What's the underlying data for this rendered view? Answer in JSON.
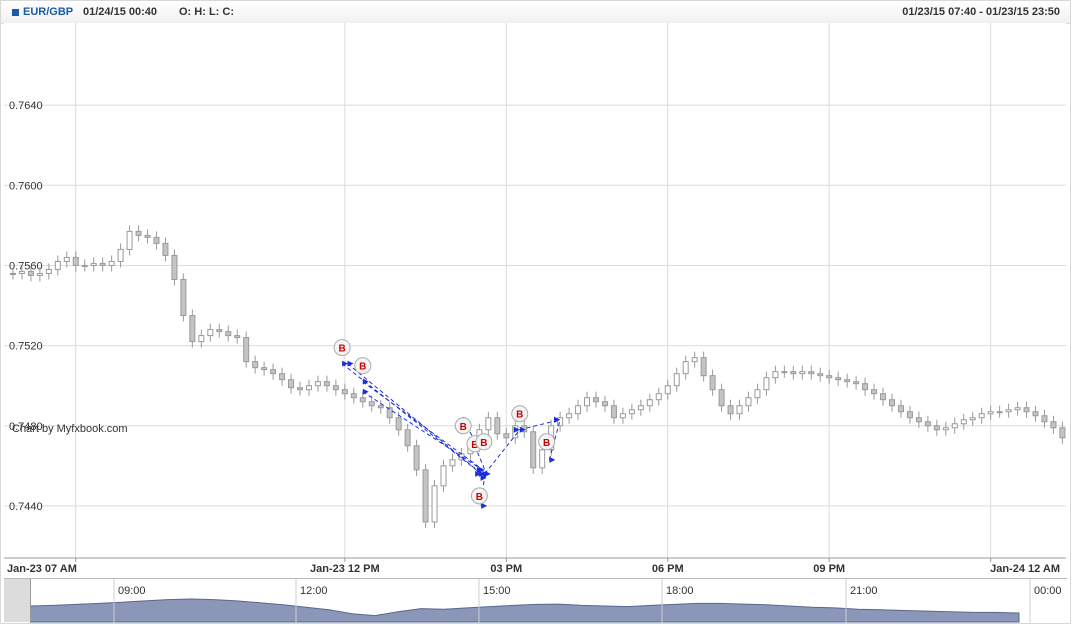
{
  "header": {
    "symbol": "EUR/GBP",
    "datetime": "01/24/15 00:40",
    "ohlc_label": "O: H: L: C:",
    "range": "01/23/15 07:40 - 01/23/15 23:50"
  },
  "watermark": "Chart by Myfxbook.com",
  "colors": {
    "candle": "#c4c4c4",
    "trade_line": "#1b2fd6",
    "marker_text": "#cc0000",
    "grid": "#dcdcdc",
    "navigator_fill": "#8a97b8"
  },
  "chart_data": {
    "type": "candlestick",
    "y_ticks": [
      "0.7440",
      "0.7480",
      "0.7520",
      "0.7560",
      "0.7600",
      "0.7640"
    ],
    "x_ticks": [
      {
        "t": 0,
        "label": "Jan-23 07 AM"
      },
      {
        "t": 300,
        "label": "Jan-23 12 PM"
      },
      {
        "t": 480,
        "label": "03 PM"
      },
      {
        "t": 660,
        "label": "06 PM"
      },
      {
        "t": 840,
        "label": "09 PM"
      },
      {
        "t": 1020,
        "label": "Jan-24 12 AM"
      }
    ],
    "ylim": [
      0.7414,
      0.7681
    ],
    "xlim": [
      -80,
      1104
    ],
    "grid": true,
    "closes": [
      [
        -80,
        0.7556
      ],
      [
        -70,
        0.7556
      ],
      [
        -60,
        0.7557
      ],
      [
        -50,
        0.7555
      ],
      [
        -40,
        0.7556
      ],
      [
        -30,
        0.7558
      ],
      [
        -20,
        0.7562
      ],
      [
        -10,
        0.7564
      ],
      [
        0,
        0.756
      ],
      [
        10,
        0.756
      ],
      [
        20,
        0.7561
      ],
      [
        30,
        0.756
      ],
      [
        40,
        0.7562
      ],
      [
        50,
        0.7568
      ],
      [
        60,
        0.7577
      ],
      [
        70,
        0.7575
      ],
      [
        80,
        0.7574
      ],
      [
        90,
        0.7571
      ],
      [
        100,
        0.7565
      ],
      [
        110,
        0.7553
      ],
      [
        120,
        0.7535
      ],
      [
        130,
        0.7522
      ],
      [
        140,
        0.7525
      ],
      [
        150,
        0.7528
      ],
      [
        160,
        0.7527
      ],
      [
        170,
        0.7525
      ],
      [
        180,
        0.7524
      ],
      [
        190,
        0.7512
      ],
      [
        200,
        0.7509
      ],
      [
        210,
        0.7508
      ],
      [
        220,
        0.7506
      ],
      [
        230,
        0.7503
      ],
      [
        240,
        0.7499
      ],
      [
        250,
        0.7498
      ],
      [
        260,
        0.75
      ],
      [
        270,
        0.7502
      ],
      [
        280,
        0.75
      ],
      [
        290,
        0.7498
      ],
      [
        300,
        0.7496
      ],
      [
        310,
        0.7494
      ],
      [
        320,
        0.7492
      ],
      [
        330,
        0.749
      ],
      [
        340,
        0.7489
      ],
      [
        350,
        0.7484
      ],
      [
        360,
        0.7478
      ],
      [
        370,
        0.747
      ],
      [
        380,
        0.7458
      ],
      [
        390,
        0.7432
      ],
      [
        400,
        0.745
      ],
      [
        410,
        0.746
      ],
      [
        420,
        0.7463
      ],
      [
        430,
        0.7466
      ],
      [
        440,
        0.747
      ],
      [
        450,
        0.7478
      ],
      [
        460,
        0.7484
      ],
      [
        470,
        0.7476
      ],
      [
        480,
        0.7474
      ],
      [
        490,
        0.748
      ],
      [
        500,
        0.7477
      ],
      [
        510,
        0.7459
      ],
      [
        520,
        0.7468
      ],
      [
        530,
        0.748
      ],
      [
        540,
        0.7484
      ],
      [
        550,
        0.7486
      ],
      [
        560,
        0.749
      ],
      [
        570,
        0.7494
      ],
      [
        580,
        0.7492
      ],
      [
        590,
        0.749
      ],
      [
        600,
        0.7484
      ],
      [
        610,
        0.7486
      ],
      [
        620,
        0.7488
      ],
      [
        630,
        0.749
      ],
      [
        640,
        0.7493
      ],
      [
        650,
        0.7496
      ],
      [
        660,
        0.75
      ],
      [
        670,
        0.7506
      ],
      [
        680,
        0.7512
      ],
      [
        690,
        0.7514
      ],
      [
        700,
        0.7505
      ],
      [
        710,
        0.7498
      ],
      [
        720,
        0.749
      ],
      [
        730,
        0.7486
      ],
      [
        740,
        0.749
      ],
      [
        750,
        0.7494
      ],
      [
        760,
        0.7498
      ],
      [
        770,
        0.7504
      ],
      [
        780,
        0.7507
      ],
      [
        790,
        0.7507
      ],
      [
        800,
        0.7506
      ],
      [
        810,
        0.7507
      ],
      [
        820,
        0.7506
      ],
      [
        830,
        0.7505
      ],
      [
        840,
        0.7504
      ],
      [
        850,
        0.7503
      ],
      [
        860,
        0.7502
      ],
      [
        870,
        0.7501
      ],
      [
        880,
        0.7498
      ],
      [
        890,
        0.7496
      ],
      [
        900,
        0.7493
      ],
      [
        910,
        0.749
      ],
      [
        920,
        0.7487
      ],
      [
        930,
        0.7484
      ],
      [
        940,
        0.7482
      ],
      [
        950,
        0.748
      ],
      [
        960,
        0.7478
      ],
      [
        970,
        0.7479
      ],
      [
        980,
        0.7481
      ],
      [
        990,
        0.7483
      ],
      [
        1000,
        0.7484
      ],
      [
        1010,
        0.7486
      ],
      [
        1020,
        0.7487
      ],
      [
        1030,
        0.7487
      ],
      [
        1040,
        0.7488
      ],
      [
        1050,
        0.7489
      ],
      [
        1060,
        0.7487
      ],
      [
        1070,
        0.7485
      ],
      [
        1080,
        0.7482
      ],
      [
        1090,
        0.7479
      ],
      [
        1100,
        0.7474
      ]
    ],
    "trade_markers": [
      {
        "t": 297,
        "price": 0.7519,
        "label": "B"
      },
      {
        "t": 320,
        "price": 0.751,
        "label": "B"
      },
      {
        "t": 432,
        "price": 0.748,
        "label": "B"
      },
      {
        "t": 445,
        "price": 0.7471,
        "label": "B"
      },
      {
        "t": 455,
        "price": 0.7472,
        "label": "B"
      },
      {
        "t": 450,
        "price": 0.7445,
        "label": "B"
      },
      {
        "t": 495,
        "price": 0.7486,
        "label": "B"
      },
      {
        "t": 525,
        "price": 0.7472,
        "label": "B"
      }
    ],
    "trade_lines": [
      [
        [
          297,
          0.7511
        ],
        [
          452,
          0.7456
        ]
      ],
      [
        [
          303,
          0.7511
        ],
        [
          458,
          0.7454
        ]
      ],
      [
        [
          320,
          0.7502
        ],
        [
          454,
          0.7458
        ]
      ],
      [
        [
          320,
          0.7497
        ],
        [
          460,
          0.7456
        ]
      ],
      [
        [
          432,
          0.7483
        ],
        [
          448,
          0.747
        ]
      ],
      [
        [
          445,
          0.747
        ],
        [
          456,
          0.7458
        ]
      ],
      [
        [
          452,
          0.744
        ],
        [
          456,
          0.7456
        ]
      ],
      [
        [
          456,
          0.7456
        ],
        [
          495,
          0.7478
        ]
      ],
      [
        [
          495,
          0.7478
        ],
        [
          540,
          0.7483
        ]
      ],
      [
        [
          528,
          0.7463
        ],
        [
          540,
          0.7483
        ]
      ]
    ]
  },
  "navigator": {
    "labels": [
      "09:00",
      "12:00",
      "15:00",
      "18:00",
      "21:00",
      "00:00"
    ],
    "profile": [
      0.5,
      0.52,
      0.55,
      0.58,
      0.62,
      0.66,
      0.7,
      0.72,
      0.7,
      0.66,
      0.6,
      0.54,
      0.46,
      0.38,
      0.26,
      0.2,
      0.32,
      0.42,
      0.4,
      0.44,
      0.48,
      0.52,
      0.55,
      0.56,
      0.52,
      0.5,
      0.48,
      0.52,
      0.55,
      0.58,
      0.58,
      0.56,
      0.54,
      0.5,
      0.46,
      0.44,
      0.4,
      0.38,
      0.36,
      0.34,
      0.32,
      0.3,
      0.3,
      0.28
    ]
  }
}
